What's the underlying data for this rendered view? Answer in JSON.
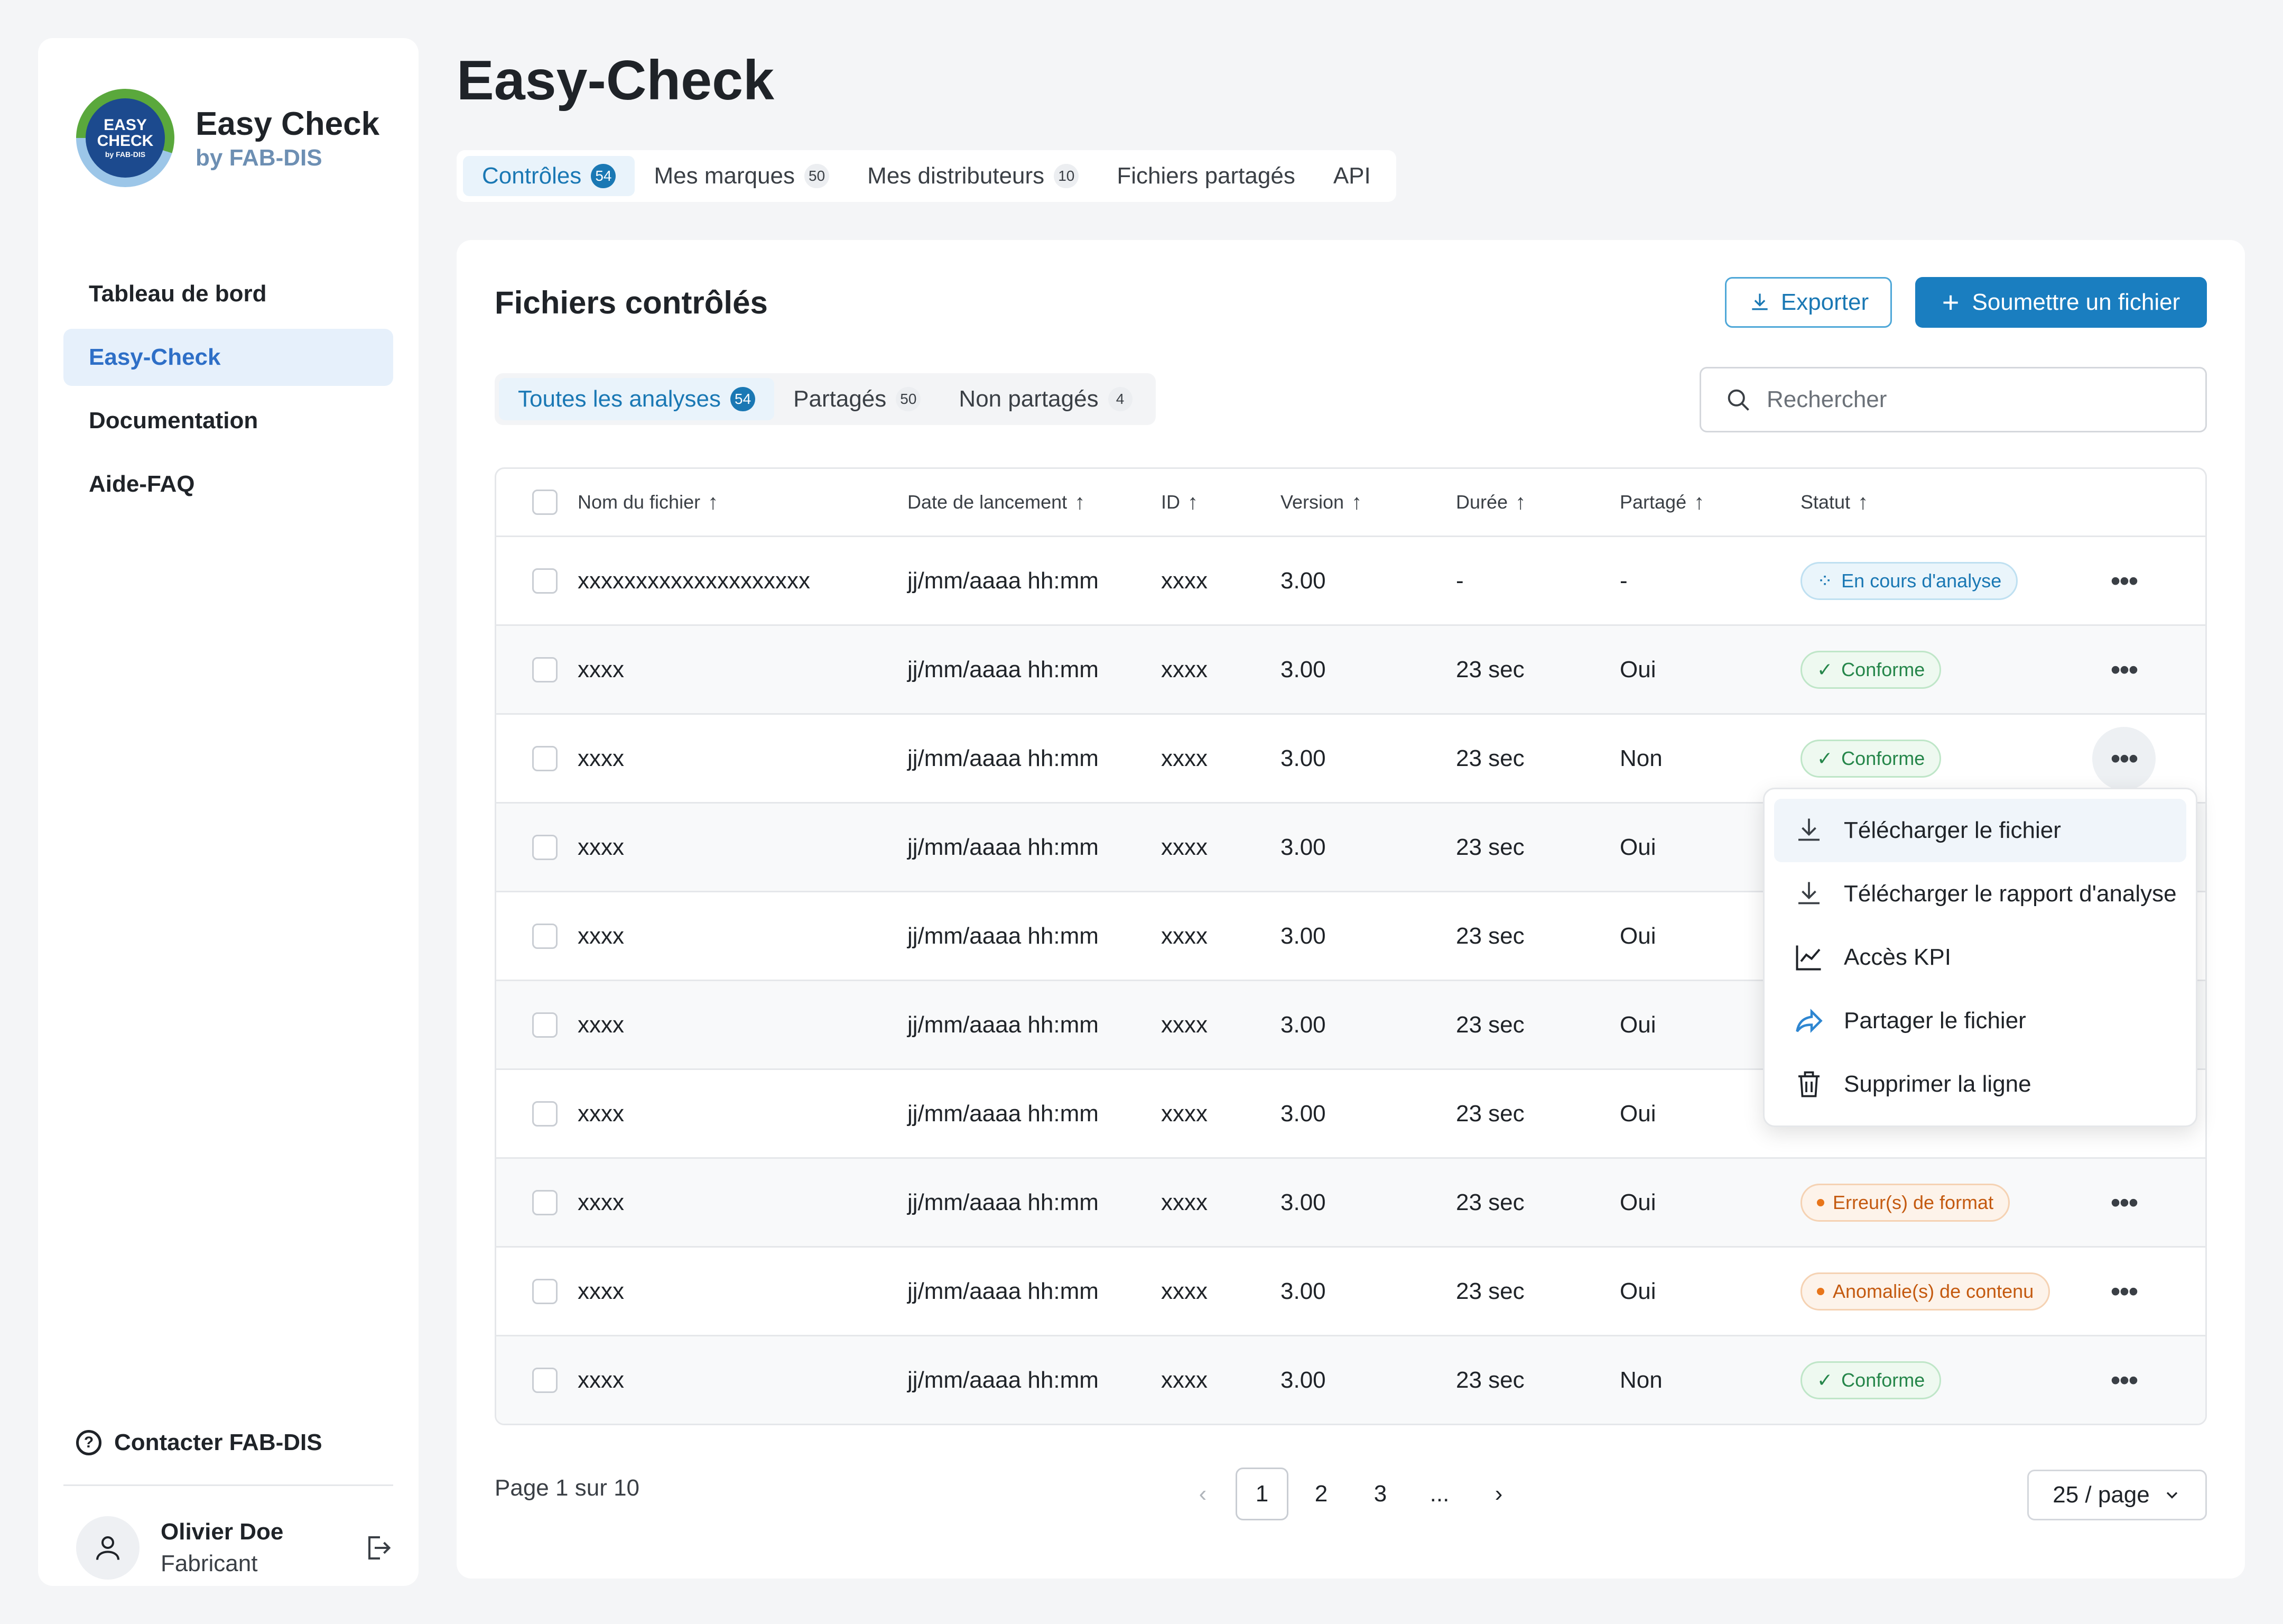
{
  "sidebar": {
    "brand": {
      "logo_text": "EASY CHECK",
      "logo_sub": "by FAB-DIS",
      "title": "Easy Check",
      "subtitle": "by FAB-DIS"
    },
    "nav": [
      {
        "label": "Tableau de bord",
        "active": false
      },
      {
        "label": "Easy-Check",
        "active": true
      },
      {
        "label": "Documentation",
        "active": false
      },
      {
        "label": "Aide-FAQ",
        "active": false
      }
    ],
    "contact_label": "Contacter FAB-DIS",
    "user": {
      "name": "Olivier Doe",
      "role": "Fabricant"
    }
  },
  "main": {
    "title": "Easy-Check",
    "tabs": [
      {
        "label": "Contrôles",
        "count": "54",
        "active": true
      },
      {
        "label": "Mes marques",
        "count": "50",
        "active": false
      },
      {
        "label": "Mes distributeurs",
        "count": "10",
        "active": false
      },
      {
        "label": "Fichiers partagés",
        "count": "",
        "active": false
      },
      {
        "label": "API",
        "count": "",
        "active": false
      }
    ]
  },
  "panel": {
    "title": "Fichiers contrôlés",
    "export_label": "Exporter",
    "submit_label": "Soumettre un fichier",
    "filters": [
      {
        "label": "Toutes les analyses",
        "count": "54",
        "active": true
      },
      {
        "label": "Partagés",
        "count": "50",
        "active": false
      },
      {
        "label": "Non partagés",
        "count": "4",
        "active": false
      }
    ],
    "search_placeholder": "Rechercher"
  },
  "table": {
    "headers": [
      "Nom du fichier",
      "Date de lancement",
      "ID",
      "Version",
      "Durée",
      "Partagé",
      "Statut"
    ],
    "rows": [
      {
        "name": "xxxxxxxxxxxxxxxxxxxx",
        "date": "jj/mm/aaaa hh:mm",
        "id": "xxxx",
        "version": "3.00",
        "duration": "-",
        "shared": "-",
        "status": "En cours d'analyse",
        "kind": "progress"
      },
      {
        "name": "xxxx",
        "date": "jj/mm/aaaa hh:mm",
        "id": "xxxx",
        "version": "3.00",
        "duration": "23 sec",
        "shared": "Oui",
        "status": "Conforme",
        "kind": "ok"
      },
      {
        "name": "xxxx",
        "date": "jj/mm/aaaa hh:mm",
        "id": "xxxx",
        "version": "3.00",
        "duration": "23 sec",
        "shared": "Non",
        "status": "Conforme",
        "kind": "ok"
      },
      {
        "name": "xxxx",
        "date": "jj/mm/aaaa hh:mm",
        "id": "xxxx",
        "version": "3.00",
        "duration": "23 sec",
        "shared": "Oui",
        "status": "",
        "kind": "hidden"
      },
      {
        "name": "xxxx",
        "date": "jj/mm/aaaa hh:mm",
        "id": "xxxx",
        "version": "3.00",
        "duration": "23 sec",
        "shared": "Oui",
        "status": "",
        "kind": "hidden"
      },
      {
        "name": "xxxx",
        "date": "jj/mm/aaaa hh:mm",
        "id": "xxxx",
        "version": "3.00",
        "duration": "23 sec",
        "shared": "Oui",
        "status": "",
        "kind": "hidden"
      },
      {
        "name": "xxxx",
        "date": "jj/mm/aaaa hh:mm",
        "id": "xxxx",
        "version": "3.00",
        "duration": "23 sec",
        "shared": "Oui",
        "status": "",
        "kind": "hidden"
      },
      {
        "name": "xxxx",
        "date": "jj/mm/aaaa hh:mm",
        "id": "xxxx",
        "version": "3.00",
        "duration": "23 sec",
        "shared": "Oui",
        "status": "Erreur(s) de format",
        "kind": "err"
      },
      {
        "name": "xxxx",
        "date": "jj/mm/aaaa hh:mm",
        "id": "xxxx",
        "version": "3.00",
        "duration": "23 sec",
        "shared": "Oui",
        "status": "Anomalie(s) de contenu",
        "kind": "err"
      },
      {
        "name": "xxxx",
        "date": "jj/mm/aaaa hh:mm",
        "id": "xxxx",
        "version": "3.00",
        "duration": "23 sec",
        "shared": "Non",
        "status": "Conforme",
        "kind": "ok"
      }
    ]
  },
  "menu": {
    "items": [
      {
        "label": "Télécharger le fichier",
        "icon": "download-icon"
      },
      {
        "label": "Télécharger le rapport d'analyse",
        "icon": "download-icon"
      },
      {
        "label": "Accès KPI",
        "icon": "chart-icon"
      },
      {
        "label": "Partager le fichier",
        "icon": "share-icon"
      },
      {
        "label": "Supprimer la ligne",
        "icon": "trash-icon"
      }
    ]
  },
  "pagination": {
    "page_label": "Page",
    "current": "1",
    "of_label": "sur",
    "total": "10",
    "pages": [
      "1",
      "2",
      "3",
      "..."
    ],
    "per_page": "25 / page"
  },
  "colors": {
    "accent": "#1a7ec0",
    "ok": "#25864a",
    "warning": "#c45a10"
  }
}
